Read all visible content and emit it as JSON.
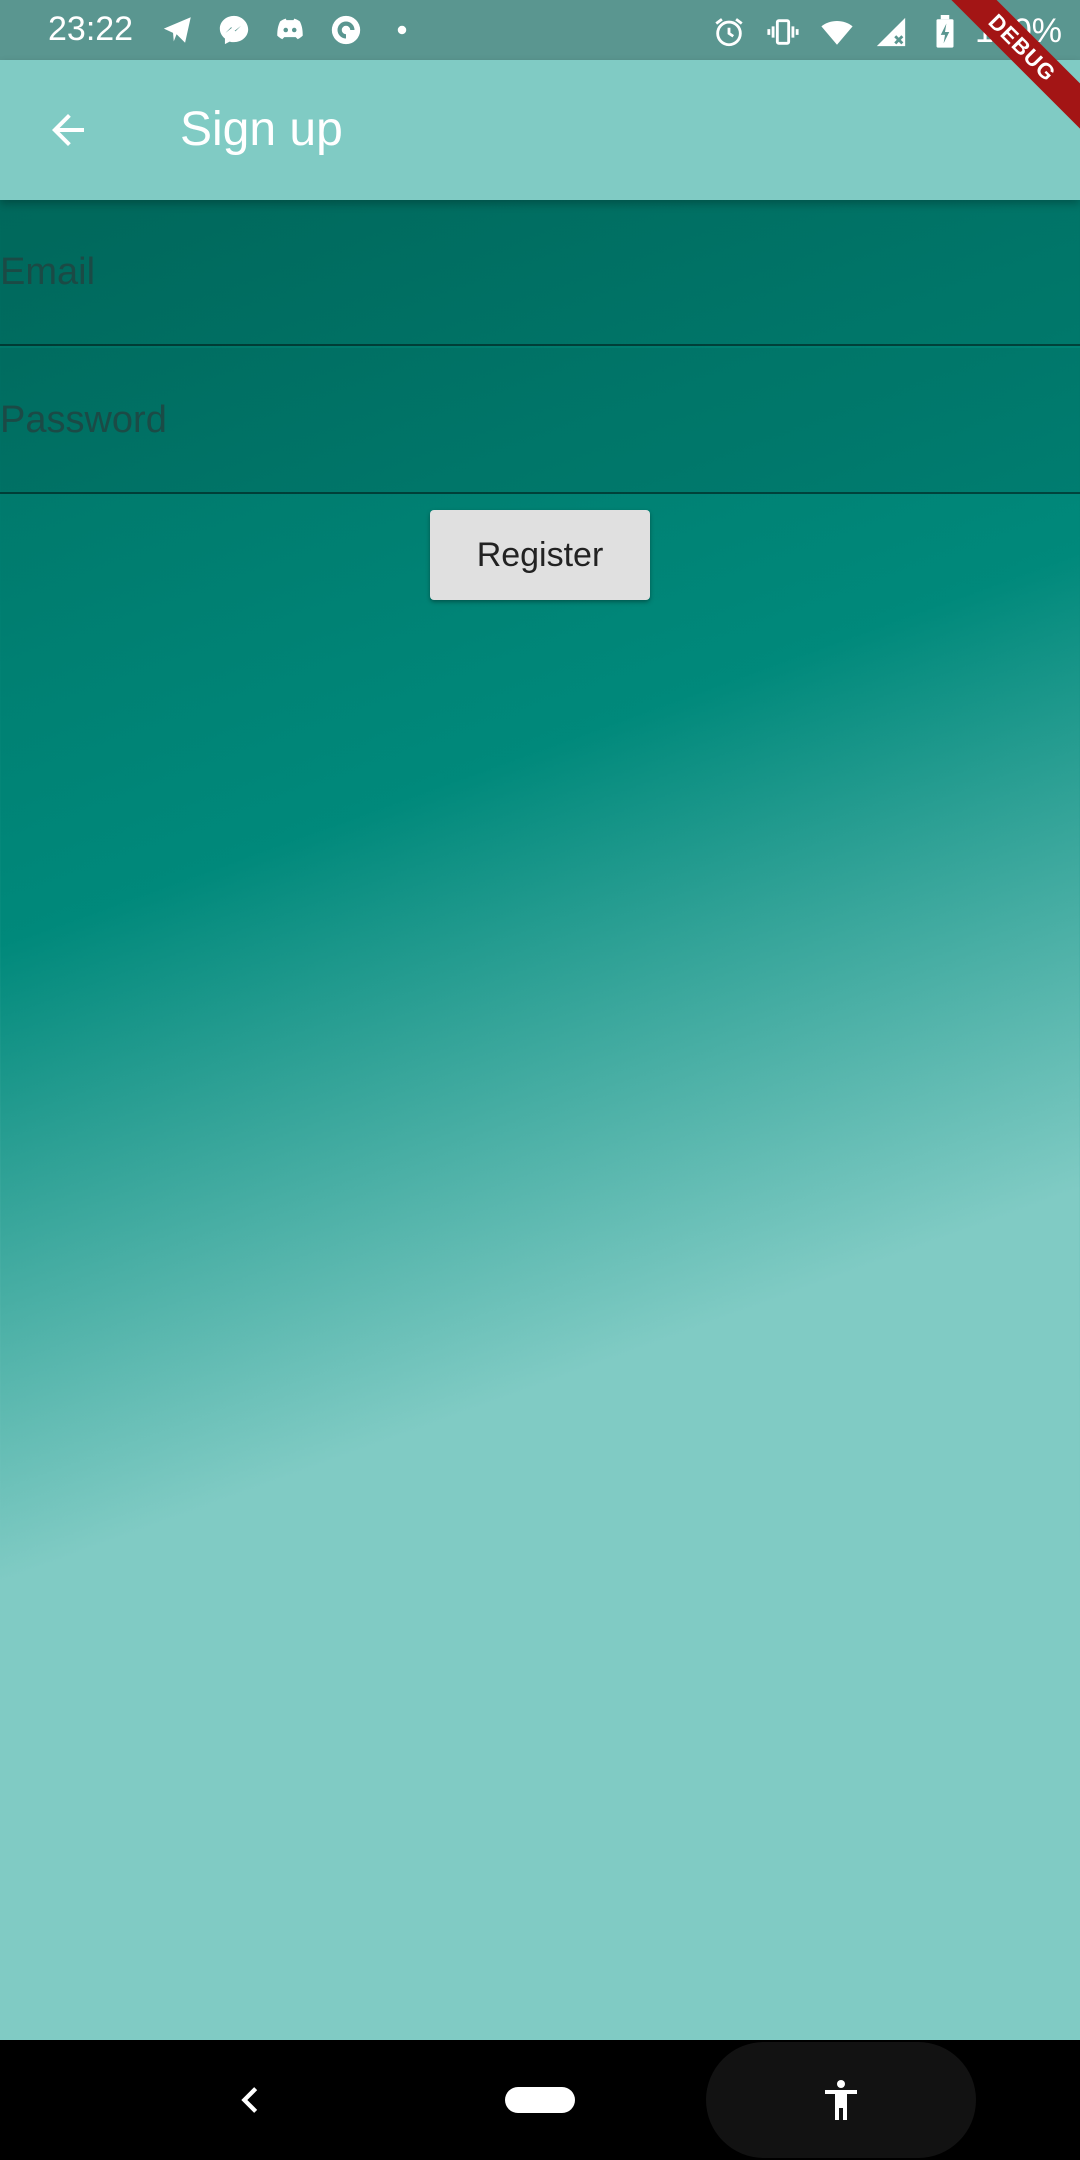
{
  "status_bar": {
    "time": "23:22",
    "notification_icons": [
      "telegram-icon",
      "messenger-icon",
      "discord-icon",
      "pocket-casts-icon",
      "more-dot-icon"
    ],
    "system_icons": [
      "alarm-icon",
      "vibrate-icon",
      "wifi-icon",
      "signal-icon",
      "battery-icon"
    ],
    "battery": "100%"
  },
  "debug_banner": "DEBUG",
  "app_bar": {
    "title": "Sign up",
    "back_icon": "arrow-back-icon"
  },
  "form": {
    "email": {
      "placeholder": "Email",
      "value": ""
    },
    "password": {
      "placeholder": "Password",
      "value": ""
    },
    "register_label": "Register"
  },
  "nav_bar": {
    "back_icon": "nav-back-icon",
    "home_icon": "home-pill-icon",
    "accessibility_icon": "accessibility-icon"
  },
  "colors": {
    "app_bar": "#80cbc4",
    "gradient_top": "#00695c",
    "gradient_mid": "#00897b",
    "gradient_bottom": "#80cbc4",
    "debug_banner": "#a31515",
    "button": "#e0e0e0"
  }
}
